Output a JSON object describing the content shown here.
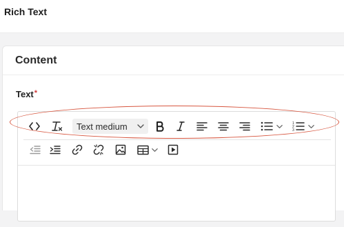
{
  "header": {
    "title": "Rich Text"
  },
  "panel": {
    "title": "Content"
  },
  "field": {
    "label": "Text",
    "required_mark": "*"
  },
  "toolbar": {
    "format_value": "Text medium",
    "row1_icons": [
      "code-view-icon",
      "clear-format-icon",
      "format-select",
      "bold-icon",
      "italic-icon",
      "align-left-icon",
      "align-center-icon",
      "align-right-icon",
      "bullet-list-icon",
      "numbered-list-icon"
    ],
    "row2_icons": [
      "outdent-icon",
      "indent-icon",
      "link-icon",
      "unlink-icon",
      "image-icon",
      "table-icon",
      "media-icon"
    ]
  },
  "colors": {
    "highlight": "#d7563f",
    "required": "#d13b3b"
  }
}
